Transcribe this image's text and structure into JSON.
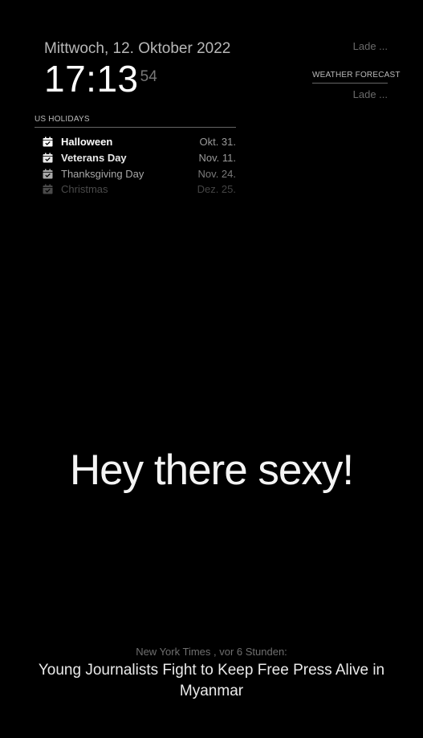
{
  "clock": {
    "date": "Mittwoch, 12. Oktober 2022",
    "hours_minutes": "17:13",
    "seconds": "54"
  },
  "calendar": {
    "header": "US HOLIDAYS",
    "icon": "calendar-check-icon",
    "events": [
      {
        "title": "Halloween",
        "date": "Okt. 31."
      },
      {
        "title": "Veterans Day",
        "date": "Nov. 11."
      },
      {
        "title": "Thanksgiving Day",
        "date": "Nov. 24."
      },
      {
        "title": "Christmas",
        "date": "Dez. 25."
      }
    ]
  },
  "weather": {
    "current_loading": "Lade ...",
    "forecast_header": "WEATHER FORECAST",
    "forecast_loading": "Lade ..."
  },
  "compliment": {
    "text": "Hey there sexy!"
  },
  "newsfeed": {
    "source": "New York Times , vor 6 Stunden:",
    "headline": "Young Journalists Fight to Keep Free Press Alive in Myanmar"
  },
  "colors": {
    "background": "#000000",
    "primary_text": "#ffffff",
    "dimmed_text": "#6a6a6a"
  }
}
